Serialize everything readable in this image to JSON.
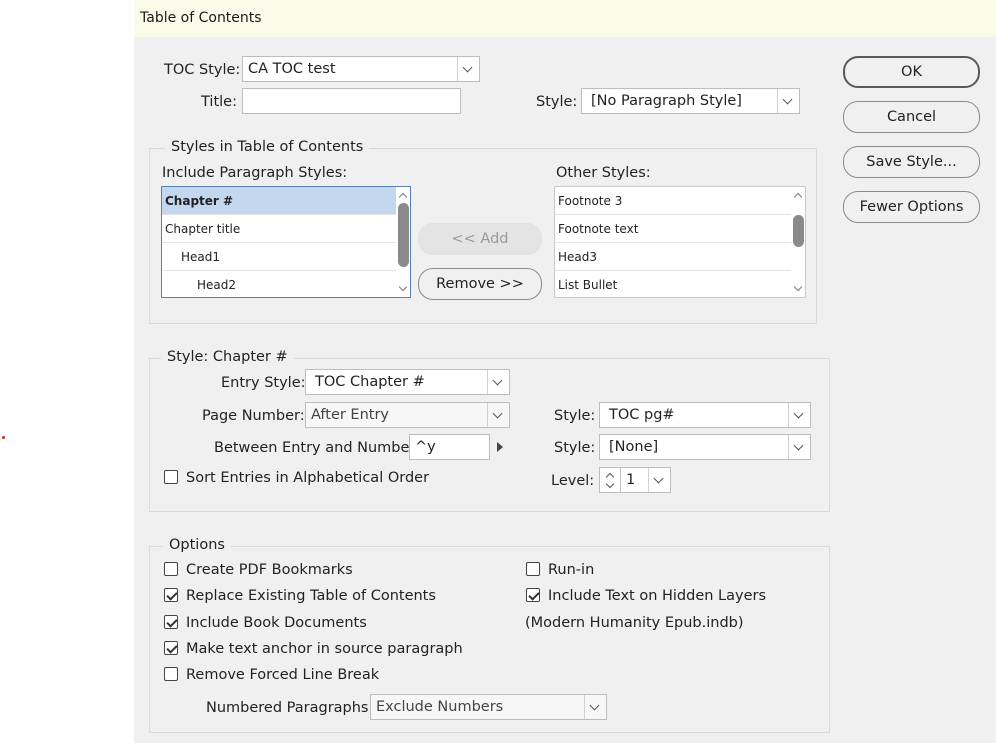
{
  "window": {
    "title": "Table of Contents"
  },
  "toc_style": {
    "label": "TOC Style:",
    "value": "CA TOC test"
  },
  "title_row": {
    "label": "Title:",
    "value": "",
    "style_label": "Style:",
    "style_value": "[No Paragraph Style]"
  },
  "buttons": {
    "ok": "OK",
    "cancel": "Cancel",
    "save_style": "Save Style...",
    "fewer_options": "Fewer Options"
  },
  "styles_group": {
    "title": "Styles in Table of Contents",
    "include_label": "Include Paragraph Styles:",
    "other_label": "Other Styles:",
    "add": "<< Add",
    "remove": "Remove >>",
    "include_items": [
      "Chapter #",
      "Chapter title",
      "Head1",
      "Head2"
    ],
    "other_items": [
      "Footnote 3",
      "Footnote text",
      "Head3",
      "List Bullet"
    ]
  },
  "entry_group": {
    "title": "Style: Chapter #",
    "entry_style_label": "Entry Style:",
    "entry_style_value": "TOC Chapter #",
    "page_number_label": "Page Number:",
    "page_number_value": "After Entry",
    "page_style_label": "Style:",
    "page_style_value": "TOC pg#",
    "between_label": "Between Entry and Number:",
    "between_value": "^y",
    "between_style_label": "Style:",
    "between_style_value": "[None]",
    "sort_label": "Sort Entries in Alphabetical Order",
    "sort_checked": false,
    "level_label": "Level:",
    "level_value": "1"
  },
  "options_group": {
    "title": "Options",
    "create_pdf": {
      "label": "Create PDF Bookmarks",
      "checked": false
    },
    "replace_existing": {
      "label": "Replace Existing Table of Contents",
      "checked": true
    },
    "include_book": {
      "label": "Include Book Documents",
      "checked": true
    },
    "text_anchor": {
      "label": "Make text anchor in source paragraph",
      "checked": true
    },
    "remove_break": {
      "label": "Remove Forced Line Break",
      "checked": false
    },
    "run_in": {
      "label": "Run-in",
      "checked": false
    },
    "hidden_layers": {
      "label": "Include Text on Hidden Layers",
      "checked": true
    },
    "book_name": "(Modern Humanity Epub.indb)",
    "numbered_label": "Numbered Paragraphs:",
    "numbered_value": "Exclude Numbers"
  }
}
